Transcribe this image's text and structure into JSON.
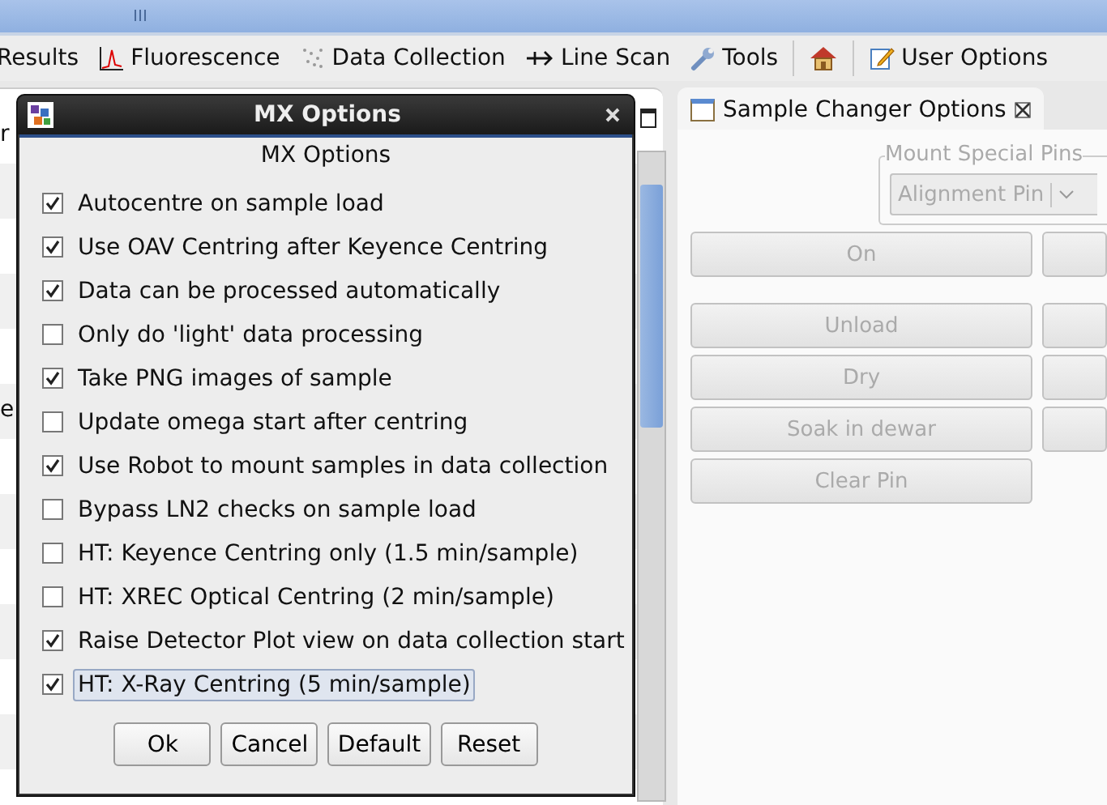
{
  "toolbar": {
    "items": [
      {
        "kind": "text",
        "label": "Results"
      },
      {
        "kind": "chart",
        "label": "Fluorescence"
      },
      {
        "kind": "dots",
        "label": "Data Collection"
      },
      {
        "kind": "arrow",
        "label": "Line Scan"
      },
      {
        "kind": "wrench",
        "label": "Tools"
      },
      {
        "kind": "home"
      },
      {
        "kind": "edit",
        "label": "User Options"
      }
    ]
  },
  "left_panel": {
    "fragments": [
      "r",
      "e"
    ]
  },
  "right_panel": {
    "tab": {
      "title": "Sample Changer Options"
    },
    "mount_group": {
      "title": "Mount Special Pins",
      "combo": {
        "value": "Alignment Pin",
        "disabled": true
      }
    },
    "buttons": [
      {
        "label": "On",
        "disabled": true
      },
      {
        "label": "Unload",
        "disabled": true
      },
      {
        "label": "Dry",
        "disabled": true
      },
      {
        "label": "Soak in dewar",
        "disabled": true
      },
      {
        "label": "Clear Pin",
        "disabled": true
      }
    ]
  },
  "dialog": {
    "title": "MX Options",
    "heading": "MX Options",
    "options": [
      {
        "label": "Autocentre on sample load",
        "checked": true,
        "focused": false
      },
      {
        "label": "Use OAV Centring after Keyence Centring",
        "checked": true,
        "focused": false
      },
      {
        "label": "Data can be processed automatically",
        "checked": true,
        "focused": false
      },
      {
        "label": "Only do 'light' data processing",
        "checked": false,
        "focused": false
      },
      {
        "label": "Take PNG images of sample",
        "checked": true,
        "focused": false
      },
      {
        "label": "Update omega start after centring",
        "checked": false,
        "focused": false
      },
      {
        "label": "Use Robot to mount samples in data collection",
        "checked": true,
        "focused": false
      },
      {
        "label": "Bypass LN2 checks on sample load",
        "checked": false,
        "focused": false
      },
      {
        "label": "HT: Keyence Centring only (1.5 min/sample)",
        "checked": false,
        "focused": false
      },
      {
        "label": "HT: XREC Optical Centring (2 min/sample)",
        "checked": false,
        "focused": false
      },
      {
        "label": "Raise Detector Plot view on data collection start",
        "checked": true,
        "focused": false
      },
      {
        "label": "HT: X-Ray Centring (5 min/sample)",
        "checked": true,
        "focused": true
      }
    ],
    "buttons": [
      "Ok",
      "Cancel",
      "Default",
      "Reset"
    ]
  }
}
